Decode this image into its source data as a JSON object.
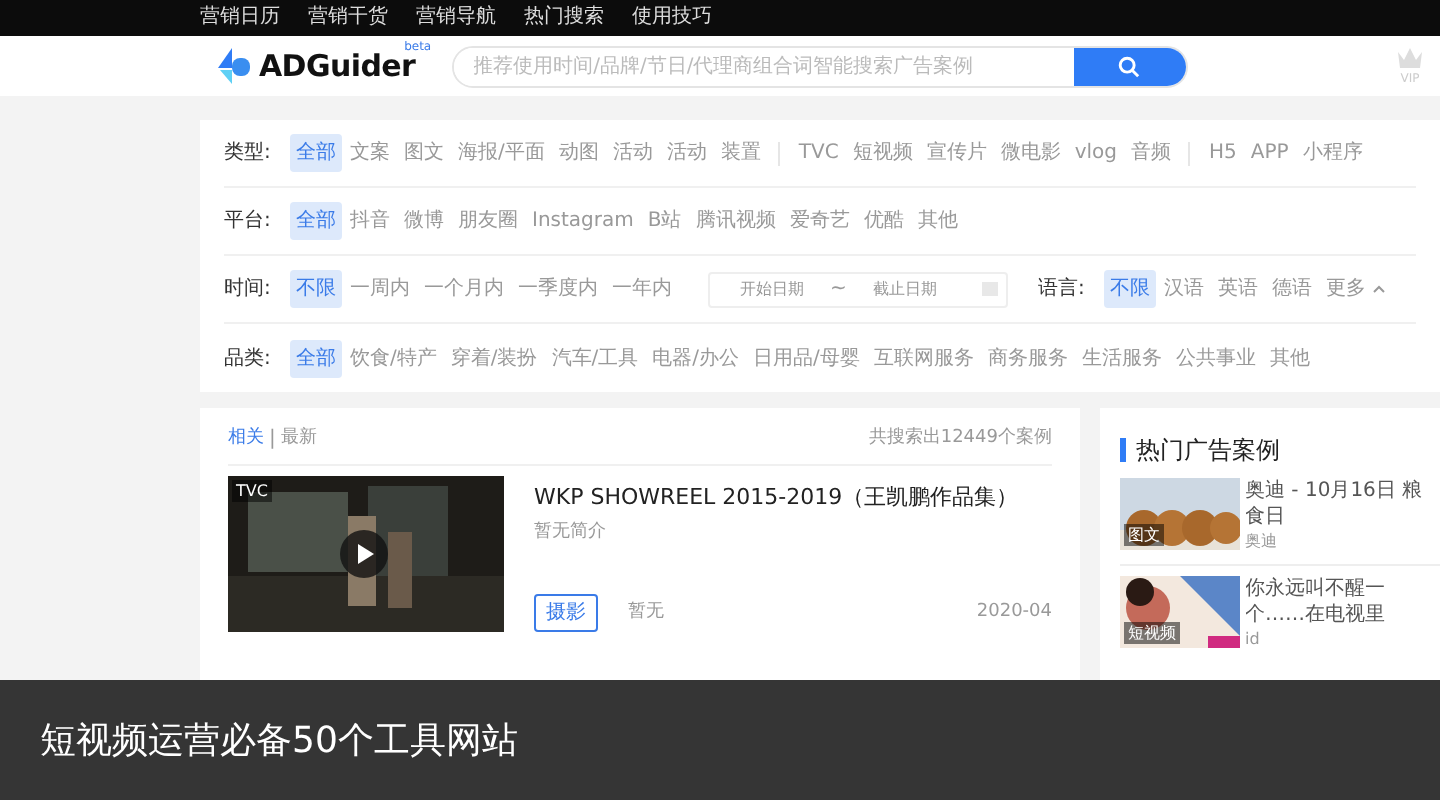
{
  "top_nav": [
    "营销日历",
    "营销干货",
    "营销导航",
    "热门搜索",
    "使用技巧"
  ],
  "header": {
    "logo": "ADGuider",
    "logo_badge": "beta",
    "search": {
      "placeholder": "推荐使用时间/品牌/节日/代理商组合词智能搜索广告案例"
    },
    "vip": "VIP"
  },
  "filters": [
    {
      "label": "类型:",
      "options": [
        {
          "text": "全部",
          "selected": true
        },
        {
          "text": "文案",
          "selected": false
        },
        {
          "text": "图文",
          "selected": false
        },
        {
          "text": "海报/平面",
          "selected": false
        },
        {
          "text": "动图",
          "selected": false
        },
        {
          "text": "活动",
          "selected": false
        },
        {
          "text": "活动",
          "selected": false
        },
        {
          "text": "装置",
          "selected": false
        },
        {
          "kind": "divider"
        },
        {
          "text": "TVC",
          "selected": false
        },
        {
          "text": "短视频",
          "selected": false
        },
        {
          "text": "宣传片",
          "selected": false
        },
        {
          "text": "微电影",
          "selected": false
        },
        {
          "text": "vlog",
          "selected": false
        },
        {
          "text": "音频",
          "selected": false
        },
        {
          "kind": "divider"
        },
        {
          "text": "H5",
          "selected": false
        },
        {
          "text": "APP",
          "selected": false
        },
        {
          "text": "小程序",
          "selected": false
        }
      ]
    },
    {
      "label": "平台:",
      "options": [
        {
          "text": "全部",
          "selected": true
        },
        {
          "text": "抖音",
          "selected": false
        },
        {
          "text": "微博",
          "selected": false
        },
        {
          "text": "朋友圈",
          "selected": false
        },
        {
          "text": "Instagram",
          "selected": false
        },
        {
          "text": "B站",
          "selected": false
        },
        {
          "text": "腾讯视频",
          "selected": false
        },
        {
          "text": "爱奇艺",
          "selected": false
        },
        {
          "text": "优酷",
          "selected": false
        },
        {
          "text": "其他",
          "selected": false
        }
      ]
    },
    {
      "label": "时间:",
      "options": [
        {
          "text": "不限",
          "selected": true
        },
        {
          "text": "一周内",
          "selected": false
        },
        {
          "text": "一个月内",
          "selected": false
        },
        {
          "text": "一季度内",
          "selected": false
        },
        {
          "text": "一年内",
          "selected": false
        }
      ],
      "date_range": {
        "start_placeholder": "开始日期",
        "separator": "~",
        "end_placeholder": "截止日期"
      },
      "language": {
        "label": "语言:",
        "options": [
          {
            "text": "不限",
            "selected": true
          },
          {
            "text": "汉语",
            "selected": false
          },
          {
            "text": "英语",
            "selected": false
          },
          {
            "text": "德语",
            "selected": false
          }
        ],
        "more": "更多"
      }
    },
    {
      "label": "品类:",
      "options": [
        {
          "text": "全部",
          "selected": true
        },
        {
          "text": "饮食/特产",
          "selected": false
        },
        {
          "text": "穿着/装扮",
          "selected": false
        },
        {
          "text": "汽车/工具",
          "selected": false
        },
        {
          "text": "电器/办公",
          "selected": false
        },
        {
          "text": "日用品/母婴",
          "selected": false
        },
        {
          "text": "互联网服务",
          "selected": false
        },
        {
          "text": "商务服务",
          "selected": false
        },
        {
          "text": "生活服务",
          "selected": false
        },
        {
          "text": "公共事业",
          "selected": false
        },
        {
          "text": "其他",
          "selected": false
        }
      ]
    }
  ],
  "results": {
    "sort": [
      {
        "text": "相关",
        "selected": true
      },
      {
        "text": "最新",
        "selected": false
      }
    ],
    "sort_separator": "|",
    "total": "共搜索出12449个案例",
    "items": [
      {
        "tag": "TVC",
        "title": "WKP SHOWREEL 2015-2019（王凯鹏作品集）",
        "summary": "暂无简介",
        "category": "摄影",
        "agency": "暂无",
        "date": "2020-04"
      }
    ]
  },
  "hot_cases": {
    "title": "热门广告案例",
    "items": [
      {
        "tag": "图文",
        "title": "奥迪 - 10月16日 粮食日",
        "brand": "奥迪"
      },
      {
        "tag": "短视频",
        "title": "你永远叫不醒一个……在电视里",
        "brand": "id"
      }
    ]
  },
  "caption": "短视频运营必备50个工具网站"
}
